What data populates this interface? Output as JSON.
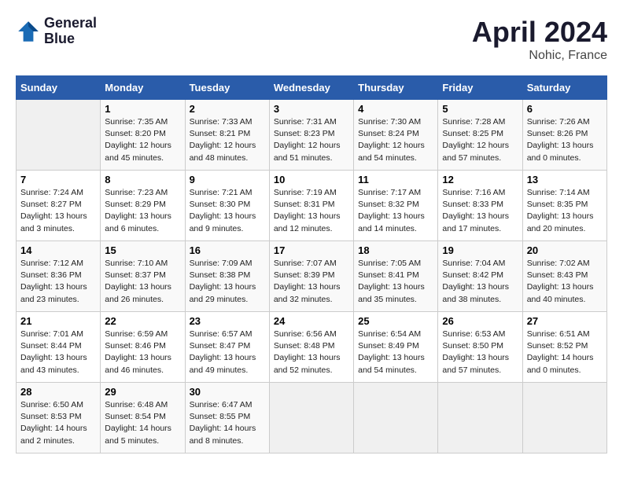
{
  "header": {
    "logo_line1": "General",
    "logo_line2": "Blue",
    "main_title": "April 2024",
    "subtitle": "Nohic, France"
  },
  "days_of_week": [
    "Sunday",
    "Monday",
    "Tuesday",
    "Wednesday",
    "Thursday",
    "Friday",
    "Saturday"
  ],
  "weeks": [
    [
      {
        "day": "",
        "info": ""
      },
      {
        "day": "1",
        "info": "Sunrise: 7:35 AM\nSunset: 8:20 PM\nDaylight: 12 hours\nand 45 minutes."
      },
      {
        "day": "2",
        "info": "Sunrise: 7:33 AM\nSunset: 8:21 PM\nDaylight: 12 hours\nand 48 minutes."
      },
      {
        "day": "3",
        "info": "Sunrise: 7:31 AM\nSunset: 8:23 PM\nDaylight: 12 hours\nand 51 minutes."
      },
      {
        "day": "4",
        "info": "Sunrise: 7:30 AM\nSunset: 8:24 PM\nDaylight: 12 hours\nand 54 minutes."
      },
      {
        "day": "5",
        "info": "Sunrise: 7:28 AM\nSunset: 8:25 PM\nDaylight: 12 hours\nand 57 minutes."
      },
      {
        "day": "6",
        "info": "Sunrise: 7:26 AM\nSunset: 8:26 PM\nDaylight: 13 hours\nand 0 minutes."
      }
    ],
    [
      {
        "day": "7",
        "info": "Sunrise: 7:24 AM\nSunset: 8:27 PM\nDaylight: 13 hours\nand 3 minutes."
      },
      {
        "day": "8",
        "info": "Sunrise: 7:23 AM\nSunset: 8:29 PM\nDaylight: 13 hours\nand 6 minutes."
      },
      {
        "day": "9",
        "info": "Sunrise: 7:21 AM\nSunset: 8:30 PM\nDaylight: 13 hours\nand 9 minutes."
      },
      {
        "day": "10",
        "info": "Sunrise: 7:19 AM\nSunset: 8:31 PM\nDaylight: 13 hours\nand 12 minutes."
      },
      {
        "day": "11",
        "info": "Sunrise: 7:17 AM\nSunset: 8:32 PM\nDaylight: 13 hours\nand 14 minutes."
      },
      {
        "day": "12",
        "info": "Sunrise: 7:16 AM\nSunset: 8:33 PM\nDaylight: 13 hours\nand 17 minutes."
      },
      {
        "day": "13",
        "info": "Sunrise: 7:14 AM\nSunset: 8:35 PM\nDaylight: 13 hours\nand 20 minutes."
      }
    ],
    [
      {
        "day": "14",
        "info": "Sunrise: 7:12 AM\nSunset: 8:36 PM\nDaylight: 13 hours\nand 23 minutes."
      },
      {
        "day": "15",
        "info": "Sunrise: 7:10 AM\nSunset: 8:37 PM\nDaylight: 13 hours\nand 26 minutes."
      },
      {
        "day": "16",
        "info": "Sunrise: 7:09 AM\nSunset: 8:38 PM\nDaylight: 13 hours\nand 29 minutes."
      },
      {
        "day": "17",
        "info": "Sunrise: 7:07 AM\nSunset: 8:39 PM\nDaylight: 13 hours\nand 32 minutes."
      },
      {
        "day": "18",
        "info": "Sunrise: 7:05 AM\nSunset: 8:41 PM\nDaylight: 13 hours\nand 35 minutes."
      },
      {
        "day": "19",
        "info": "Sunrise: 7:04 AM\nSunset: 8:42 PM\nDaylight: 13 hours\nand 38 minutes."
      },
      {
        "day": "20",
        "info": "Sunrise: 7:02 AM\nSunset: 8:43 PM\nDaylight: 13 hours\nand 40 minutes."
      }
    ],
    [
      {
        "day": "21",
        "info": "Sunrise: 7:01 AM\nSunset: 8:44 PM\nDaylight: 13 hours\nand 43 minutes."
      },
      {
        "day": "22",
        "info": "Sunrise: 6:59 AM\nSunset: 8:46 PM\nDaylight: 13 hours\nand 46 minutes."
      },
      {
        "day": "23",
        "info": "Sunrise: 6:57 AM\nSunset: 8:47 PM\nDaylight: 13 hours\nand 49 minutes."
      },
      {
        "day": "24",
        "info": "Sunrise: 6:56 AM\nSunset: 8:48 PM\nDaylight: 13 hours\nand 52 minutes."
      },
      {
        "day": "25",
        "info": "Sunrise: 6:54 AM\nSunset: 8:49 PM\nDaylight: 13 hours\nand 54 minutes."
      },
      {
        "day": "26",
        "info": "Sunrise: 6:53 AM\nSunset: 8:50 PM\nDaylight: 13 hours\nand 57 minutes."
      },
      {
        "day": "27",
        "info": "Sunrise: 6:51 AM\nSunset: 8:52 PM\nDaylight: 14 hours\nand 0 minutes."
      }
    ],
    [
      {
        "day": "28",
        "info": "Sunrise: 6:50 AM\nSunset: 8:53 PM\nDaylight: 14 hours\nand 2 minutes."
      },
      {
        "day": "29",
        "info": "Sunrise: 6:48 AM\nSunset: 8:54 PM\nDaylight: 14 hours\nand 5 minutes."
      },
      {
        "day": "30",
        "info": "Sunrise: 6:47 AM\nSunset: 8:55 PM\nDaylight: 14 hours\nand 8 minutes."
      },
      {
        "day": "",
        "info": ""
      },
      {
        "day": "",
        "info": ""
      },
      {
        "day": "",
        "info": ""
      },
      {
        "day": "",
        "info": ""
      }
    ]
  ]
}
